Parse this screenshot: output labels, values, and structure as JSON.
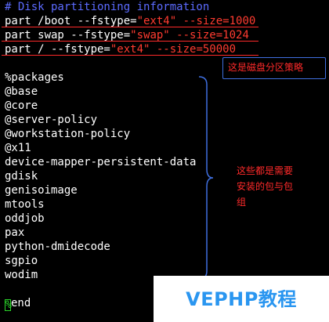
{
  "editor": {
    "comment_line": "# Disk partitioning information",
    "part_lines": [
      {
        "prefix": "part /boot --fstype=",
        "type_value": "\"ext4\"",
        "size_flag": " --size=",
        "size_value": "1000"
      },
      {
        "prefix": "part swap --fstype=",
        "type_value": "\"swap\"",
        "size_flag": " --size=",
        "size_value": "1024"
      },
      {
        "prefix": "part / --fstype=",
        "type_value": "\"ext4\"",
        "size_flag": " --size=",
        "size_value": "50000"
      }
    ],
    "blank": "",
    "packages_header": "%packages",
    "packages": [
      "@base",
      "@core",
      "@server-policy",
      "@workstation-policy",
      "@x11",
      "device-mapper-persistent-data",
      "gdisk",
      "genisoimage",
      "mtools",
      "oddjob",
      "pax",
      "python-dmidecode",
      "sgpio",
      "wodim"
    ],
    "end_cursor_char": "%",
    "end_rest": "end"
  },
  "annotations": {
    "partition_note": "这是磁盘分区策略",
    "packages_note": "这些都是需要安装的包与包组",
    "color": "#ff2a2a"
  },
  "watermark": {
    "text": "VEPHP教程",
    "color": "#2a96f0"
  }
}
